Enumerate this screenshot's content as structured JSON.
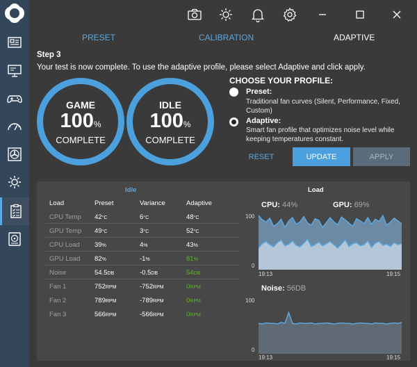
{
  "topbar": {
    "icons": [
      "camera-icon",
      "brightness-icon",
      "bell-icon",
      "gear-icon"
    ],
    "window_controls": [
      "minimize-icon",
      "maximize-icon",
      "close-icon"
    ]
  },
  "sidebar": {
    "items": [
      "dashboard-icon",
      "monitor-icon",
      "gamepad-icon",
      "gauge-icon",
      "fan-icon",
      "lighting-icon",
      "checklist-icon",
      "storage-icon"
    ],
    "active_index": 6
  },
  "tabs": [
    {
      "label": "PRESET",
      "active": false
    },
    {
      "label": "CALIBRATION",
      "active": false
    },
    {
      "label": "ADAPTIVE",
      "active": true
    }
  ],
  "step": {
    "title": "Step 3",
    "description": "Your test is now complete. To use the adaptive profile, please select Adaptive and click apply."
  },
  "rings": [
    {
      "label": "GAME",
      "value": "100",
      "unit": "%",
      "status": "COMPLETE"
    },
    {
      "label": "IDLE",
      "value": "100",
      "unit": "%",
      "status": "COMPLETE"
    }
  ],
  "profile": {
    "heading": "CHOOSE YOUR PROFILE:",
    "preset_title": "Preset:",
    "preset_desc": "Traditional fan curves (Silent, Performance, Fixed, Custom)",
    "adaptive_title": "Adaptive:",
    "adaptive_desc": "Smart fan profile that optimizes noise level while keeping temperatures constant.",
    "selected": "Adaptive"
  },
  "buttons": {
    "reset": "RESET",
    "update": "UPDATE",
    "apply": "APPLY"
  },
  "table": {
    "idle_heading": "Idle",
    "load_heading": "Load",
    "columns": [
      "Load",
      "Preset",
      "Variance",
      "Adaptive"
    ],
    "rows": [
      {
        "label": "CPU Temp",
        "preset": "42",
        "preset_unit": "°C",
        "variance": "6",
        "variance_unit": "°C",
        "adaptive": "48",
        "adaptive_unit": "°C",
        "green": false
      },
      {
        "label": "GPU Temp",
        "preset": "49",
        "preset_unit": "°C",
        "variance": "3",
        "variance_unit": "°C",
        "adaptive": "52",
        "adaptive_unit": "°C",
        "green": false
      },
      {
        "label": "CPU Load",
        "preset": "39",
        "preset_unit": "%",
        "variance": "4",
        "variance_unit": "%",
        "adaptive": "43",
        "adaptive_unit": "%",
        "green": false
      },
      {
        "label": "GPU Load",
        "preset": "82",
        "preset_unit": "%",
        "variance": "-1",
        "variance_unit": "%",
        "adaptive": "81",
        "adaptive_unit": "%",
        "green": true
      },
      {
        "label": "Noise",
        "preset": "54.5",
        "preset_unit": "DB",
        "variance": "-0.5",
        "variance_unit": "DB",
        "adaptive": "54",
        "adaptive_unit": "DB",
        "green": true
      },
      {
        "label": "Fan 1",
        "preset": "752",
        "preset_unit": "RPM",
        "variance": "-752",
        "variance_unit": "RPM",
        "adaptive": "0",
        "adaptive_unit": "RPM",
        "green": true
      },
      {
        "label": "Fan 2",
        "preset": "789",
        "preset_unit": "RPM",
        "variance": "-789",
        "variance_unit": "RPM",
        "adaptive": "0",
        "adaptive_unit": "RPM",
        "green": true
      },
      {
        "label": "Fan 3",
        "preset": "566",
        "preset_unit": "RPM",
        "variance": "-566",
        "variance_unit": "RPM",
        "adaptive": "0",
        "adaptive_unit": "RPM",
        "green": true
      }
    ]
  },
  "charts": {
    "load": {
      "cpu_label": "CPU:",
      "cpu_value": "44%",
      "gpu_label": "GPU:",
      "gpu_value": "69%",
      "y_max": "100",
      "y_min": "0",
      "x_start": "19:13",
      "x_end": "19:15"
    },
    "noise": {
      "label": "Noise:",
      "value": "56DB",
      "y_max": "100",
      "y_min": "0",
      "x_start": "19:13",
      "x_end": "19:15"
    }
  },
  "chart_data": [
    {
      "type": "area",
      "title": "Load",
      "ylim": [
        0,
        100
      ],
      "x": [
        "19:13",
        "19:15"
      ],
      "series": [
        {
          "name": "GPU",
          "values": [
            100,
            92,
            88,
            95,
            80,
            85,
            93,
            78,
            90,
            96,
            84,
            88,
            98,
            86,
            82,
            94,
            91,
            78,
            87,
            96,
            88,
            83,
            97,
            92,
            86,
            80,
            94,
            90,
            85,
            96,
            84,
            93,
            89,
            100,
            82,
            88,
            95,
            90,
            85
          ]
        },
        {
          "name": "CPU",
          "values": [
            40,
            48,
            52,
            46,
            42,
            50,
            55,
            44,
            47,
            53,
            45,
            42,
            49,
            56,
            43,
            46,
            51,
            44,
            48,
            52,
            46,
            40,
            47,
            55,
            43,
            48,
            50,
            44,
            46,
            53,
            41,
            49,
            52,
            45,
            47,
            43,
            50,
            46,
            48
          ]
        }
      ]
    },
    {
      "type": "area",
      "title": "Noise",
      "ylim": [
        0,
        100
      ],
      "x": [
        "19:13",
        "19:15"
      ],
      "series": [
        {
          "name": "Noise",
          "values": [
            56,
            55,
            57,
            56,
            56,
            55,
            58,
            56,
            76,
            56,
            55,
            57,
            56,
            56,
            57,
            55,
            56,
            56,
            57,
            56,
            55,
            56,
            57,
            56,
            56,
            55,
            56,
            57,
            56,
            56,
            55,
            57,
            56,
            56,
            55,
            56,
            57,
            56,
            58
          ]
        }
      ]
    }
  ]
}
